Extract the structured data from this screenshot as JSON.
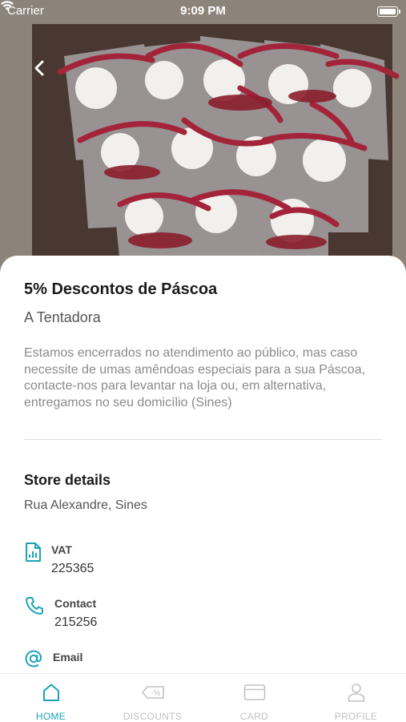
{
  "status_bar": {
    "carrier": "Carrier",
    "time": "9:09 PM"
  },
  "offer": {
    "title": "5% Descontos de Páscoa",
    "store_name": "A Tentadora",
    "description": "Estamos encerrados no atendimento ao público, mas caso necessite de umas amêndoas especiais para a sua Páscoa, contacte-nos para levantar na loja ou, em alternativa, entregamos no seu domicílio (Sines)"
  },
  "store_details": {
    "heading": "Store details",
    "address": "Rua Alexandre, Sines",
    "vat_label": "VAT",
    "vat_value": "225365",
    "contact_label": "Contact",
    "contact_value": "215256",
    "email_label": "Email"
  },
  "tabs": [
    {
      "label": "HOME",
      "icon": "home-icon",
      "active": true
    },
    {
      "label": "DISCOUNTS",
      "icon": "discount-tag-icon",
      "active": false
    },
    {
      "label": "CARD",
      "icon": "card-icon",
      "active": false
    },
    {
      "label": "PROFILE",
      "icon": "profile-icon",
      "active": false
    }
  ],
  "colors": {
    "accent": "#1aa3b5",
    "ribbon": "#a3243a",
    "inactive": "#c2c2c2"
  }
}
